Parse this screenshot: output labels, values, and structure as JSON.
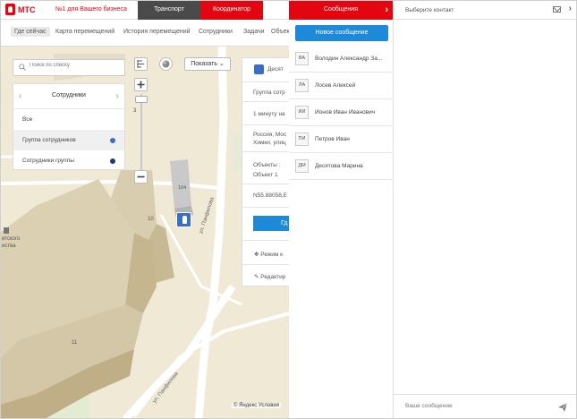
{
  "header": {
    "logo_text": "МТС",
    "slogan": "№1 для Вашего бизнеса",
    "tabs": [
      {
        "label": "Транспорт"
      },
      {
        "label": "Координатор"
      }
    ]
  },
  "subnav": {
    "items": [
      {
        "label": "Где сейчас"
      },
      {
        "label": "Карта перемещений"
      },
      {
        "label": "История перемещений"
      },
      {
        "label": "Сотрудники"
      },
      {
        "label": "Задачи"
      },
      {
        "label": "Объек"
      }
    ]
  },
  "map": {
    "search_placeholder": "Поиск по списку",
    "employees_panel": {
      "title": "Сотрудники",
      "rows": [
        {
          "label": "Все"
        },
        {
          "label": "Группа сотрудников",
          "dot_color": "#3d6dc2"
        },
        {
          "label": "Сотрудники группы",
          "dot_color": "#1f3a6e"
        }
      ]
    },
    "show_label": "Показать",
    "labels": {
      "building_104": "104",
      "building_10": "10",
      "building_11": "11",
      "zoom_mark": "3",
      "place_line1": "етского",
      "place_line2": "иства",
      "street_top": "ул. Панфилова",
      "street_bottom": "ул. Панфилова"
    },
    "info_card": {
      "title": "Десят",
      "group": "Группа сотр",
      "time": "1 минуту на",
      "address_1": "Россия, Мос",
      "address_2": "Химки, улиц",
      "objects_1": "Объекты :",
      "objects_2": "Объект 1",
      "coords": "N55.88058,Е",
      "button_label": "Гд",
      "mode_label": "Режим к",
      "edit_label": "Редактир"
    },
    "attribution": "© Яндекс Условия"
  },
  "messages": {
    "header_title": "Сообщения",
    "new_message_label": "Новое сообщение",
    "contacts": [
      {
        "initials": "ВА",
        "name": "Володин Александр За..."
      },
      {
        "initials": "ЛА",
        "name": "Лосев Алексей"
      },
      {
        "initials": "ИИ",
        "name": "Ионов Иван Иванович"
      },
      {
        "initials": "ПИ",
        "name": "Петров Иван"
      },
      {
        "initials": "ДМ",
        "name": "Десятова Марина"
      }
    ]
  },
  "chat": {
    "title": "Выберите контакт",
    "input_placeholder": "Ваше сообщение"
  },
  "colors": {
    "brand_red": "#e30611",
    "accent_blue": "#1e88d9",
    "marker_blue": "#3d6dc2",
    "map_background": "#efe9d6"
  }
}
